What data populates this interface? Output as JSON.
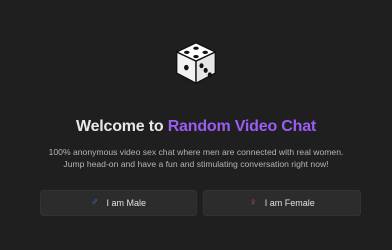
{
  "hero": {
    "title_prefix": "Welcome to ",
    "title_accent": "Random Video Chat",
    "description_line1": "100% anonymous video sex chat where men are connected with real women.",
    "description_line2": "Jump head-on and have a fun and stimulating conversation right now!"
  },
  "buttons": {
    "male_label": "I am Male",
    "female_label": "I am Female"
  },
  "icons": {
    "dice": "dice-icon",
    "male": "male-symbol-icon",
    "female": "female-symbol-icon"
  },
  "colors": {
    "accent": "#9b5cf6",
    "male": "#3b82f6",
    "female": "#e5484d",
    "background": "#1f1f1f",
    "button_bg": "#2c2c2c"
  }
}
